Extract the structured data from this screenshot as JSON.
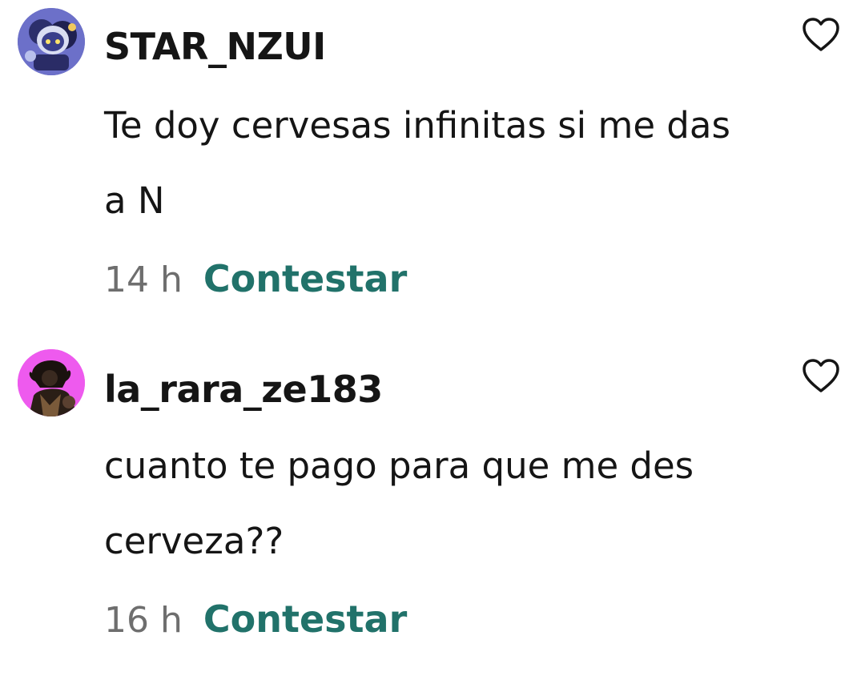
{
  "comments": [
    {
      "avatar_icon": "robot-character-avatar",
      "username": "STAR_NZUI",
      "text": "Te doy cervesas infinitas si me das a N",
      "timestamp": "14 h",
      "reply_label": "Contestar",
      "like_icon": "heart-outline-icon"
    },
    {
      "avatar_icon": "dark-character-avatar",
      "username": "la_rara_ze183",
      "text": "cuanto te pago para que me des cerveza??",
      "timestamp": "16 h",
      "reply_label": "Contestar",
      "like_icon": "heart-outline-icon"
    }
  ],
  "colors": {
    "reply": "#21726a",
    "timestamp": "#6e6e6e",
    "text": "#151515"
  }
}
